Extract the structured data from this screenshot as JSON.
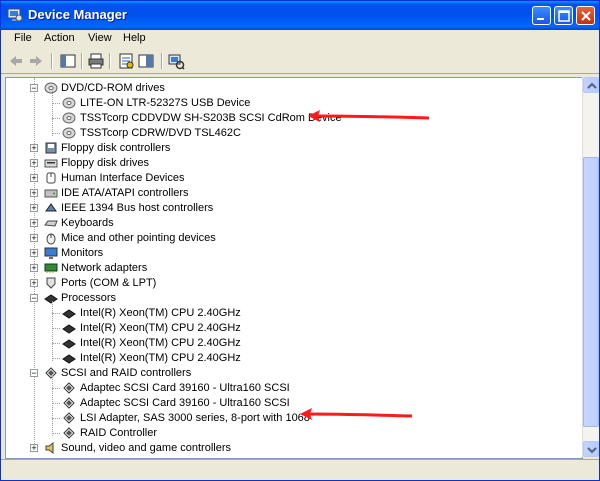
{
  "window": {
    "title": "Device Manager"
  },
  "menu": {
    "file": "File",
    "action": "Action",
    "view": "View",
    "help": "Help"
  },
  "toolbar": {
    "icons": [
      "back-arrow-icon",
      "forward-arrow-icon",
      "properties-icon",
      "print-icon",
      "help-icon",
      "show-hide-console-tree-icon",
      "scan-hardware-icon"
    ]
  },
  "tree": {
    "dvd_drives": {
      "label": "DVD/CD-ROM drives",
      "children": [
        "LITE-ON LTR-52327S USB Device",
        "TSSTcorp CDDVDW SH-S203B SCSI CdRom Device",
        "TSSTcorp CDRW/DVD TSL462C"
      ]
    },
    "floppy_controllers": "Floppy disk controllers",
    "floppy_drives": "Floppy disk drives",
    "hid": "Human Interface Devices",
    "ide": "IDE ATA/ATAPI controllers",
    "ieee1394": "IEEE 1394 Bus host controllers",
    "keyboards": "Keyboards",
    "mice": "Mice and other pointing devices",
    "monitors": "Monitors",
    "network": "Network adapters",
    "ports": "Ports (COM & LPT)",
    "processors": {
      "label": "Processors",
      "children": [
        "Intel(R) Xeon(TM) CPU 2.40GHz",
        "Intel(R) Xeon(TM) CPU 2.40GHz",
        "Intel(R) Xeon(TM) CPU 2.40GHz",
        "Intel(R) Xeon(TM) CPU 2.40GHz"
      ]
    },
    "scsi": {
      "label": "SCSI and RAID controllers",
      "children": [
        "Adaptec SCSI Card 39160 - Ultra160 SCSI",
        "Adaptec SCSI Card 39160 - Ultra160 SCSI",
        "LSI Adapter, SAS 3000 series, 8-port with 1068",
        "RAID Controller"
      ]
    },
    "sound": "Sound, video and game controllers"
  },
  "colors": {
    "title_blue": "#0053ee",
    "annotation_red": "#ff1a1a",
    "tree_border": "#7f9db9"
  }
}
